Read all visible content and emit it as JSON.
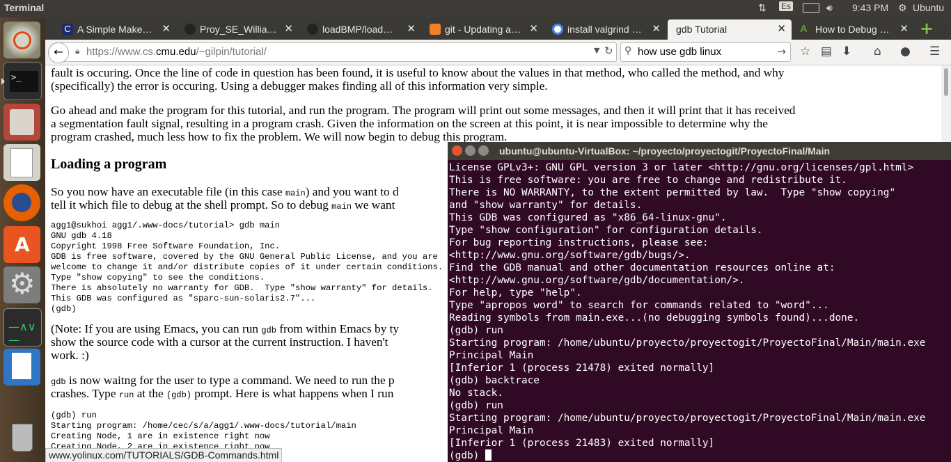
{
  "topbar": {
    "app_title": "Terminal",
    "keyboard": "Es",
    "time": "9:43 PM",
    "user": "Ubuntu"
  },
  "launcher": {
    "items": [
      "Ubuntu Dash",
      "Terminal",
      "Files",
      "Text Editor",
      "Firefox",
      "Ubuntu Software",
      "System Settings",
      "System Monitor",
      "LibreOffice Writer",
      "Trash"
    ]
  },
  "tabs": [
    {
      "label": "A Simple Make…",
      "favicon": "C"
    },
    {
      "label": "Proy_SE_Willia…",
      "favicon": "github"
    },
    {
      "label": "loadBMP/load…",
      "favicon": "github"
    },
    {
      "label": "git - Updating a…",
      "favicon": "stackoverflow"
    },
    {
      "label": "install valgrind …",
      "favicon": "google"
    },
    {
      "label": "gdb Tutorial",
      "favicon": "none",
      "active": true
    },
    {
      "label": "How to Debug …",
      "favicon": "A"
    }
  ],
  "navbar": {
    "url_prefix": "https://www.cs.",
    "url_domain": "cmu.edu",
    "url_suffix": "/~gilpin/tutorial/",
    "search_value": "how use gdb linux"
  },
  "page": {
    "p1a": "fault is occuring. Once the line of code in question has been found, it is useful to know about the values in that method, who called the method, and why",
    "p1b": "(specifically) the error is occuring. Using a debugger makes finding all of this information very simple.",
    "p2a": "Go ahead and make the program for this tutorial, and run the program. The program will print out some messages, and then it will print that it has received",
    "p2b": "a segmentation fault signal, resulting in a program crash. Given the information on the screen at this point, it is near impossible to determine why the",
    "p2c": "program crashed, much less how to fix the problem. We will now begin to debug this program.",
    "heading": "Loading a program",
    "p3a_pre": "So you now have an executable file (in this case ",
    "p3a_code": "main",
    "p3a_post": ") and you want to d",
    "p3b_pre": "tell it which file to debug at the shell prompt. So to debug ",
    "p3b_code": "main",
    "p3b_post": " we want",
    "code1": "agg1@sukhoi agg1/.www-docs/tutorial> gdb main\nGNU gdb 4.18\nCopyright 1998 Free Software Foundation, Inc.\nGDB is free software, covered by the GNU General Public License, and you are\nwelcome to change it and/or distribute copies of it under certain conditions.\nType \"show copying\" to see the conditions.\nThere is absolutely no warranty for GDB.  Type \"show warranty\" for details.\nThis GDB was configured as \"sparc-sun-solaris2.7\"...\n(gdb)",
    "p4a_pre": "(Note: If you are using Emacs, you can run ",
    "p4a_code": "gdb",
    "p4a_post": " from within Emacs by ty",
    "p4b": "show the source code with a cursor at the current instruction. I haven't",
    "p4c": "work. :)",
    "p5a_code": "gdb",
    "p5a_post": " is now waitng for the user to type a command. We need to run the p",
    "p5b_pre": "crashes. Type ",
    "p5b_code": "run",
    "p5b_mid": " at the ",
    "p5b_code2": "(gdb)",
    "p5b_post": " prompt. Here is what happens when I run",
    "code2": "(gdb) run\nStarting program: /home/cec/s/a/agg1/.www-docs/tutorial/main\nCreating Node, 1 are in existence right now\nCreating Node, 2 are in existence right now"
  },
  "status_url": "www.yolinux.com/TUTORIALS/GDB-Commands.html",
  "terminal": {
    "title": "ubuntu@ubuntu-VirtualBox: ~/proyecto/proyectogit/ProyectoFinal/Main",
    "output": "License GPLv3+: GNU GPL version 3 or later <http://gnu.org/licenses/gpl.html>\nThis is free software: you are free to change and redistribute it.\nThere is NO WARRANTY, to the extent permitted by law.  Type \"show copying\"\nand \"show warranty\" for details.\nThis GDB was configured as \"x86_64-linux-gnu\".\nType \"show configuration\" for configuration details.\nFor bug reporting instructions, please see:\n<http://www.gnu.org/software/gdb/bugs/>.\nFind the GDB manual and other documentation resources online at:\n<http://www.gnu.org/software/gdb/documentation/>.\nFor help, type \"help\".\nType \"apropos word\" to search for commands related to \"word\"...\nReading symbols from main.exe...(no debugging symbols found)...done.\n(gdb) run\nStarting program: /home/ubuntu/proyecto/proyectogit/ProyectoFinal/Main/main.exe\nPrincipal Main\n[Inferior 1 (process 21478) exited normally]\n(gdb) backtrace\nNo stack.\n(gdb) run\nStarting program: /home/ubuntu/proyecto/proyectogit/ProyectoFinal/Main/main.exe\nPrincipal Main\n[Inferior 1 (process 21483) exited normally]",
    "prompt": "(gdb) "
  }
}
